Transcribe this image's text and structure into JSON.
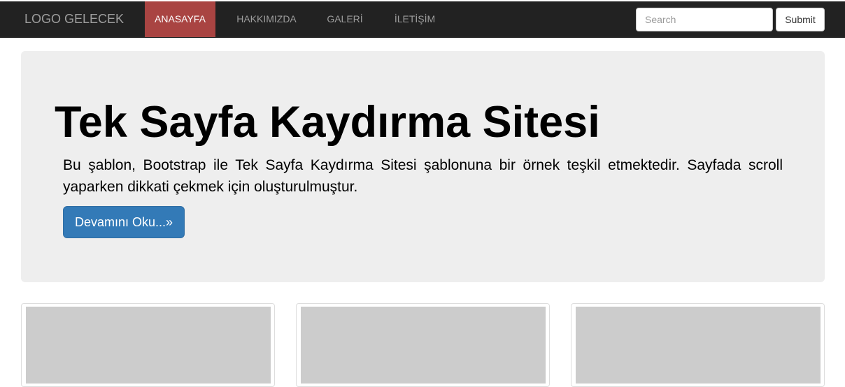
{
  "navbar": {
    "brand": "LOGO GELECEK",
    "items": [
      {
        "label": "ANASAYFA",
        "active": true
      },
      {
        "label": "HAKKIMIZDA",
        "active": false
      },
      {
        "label": "GALERİ",
        "active": false
      },
      {
        "label": "İLETİŞİM",
        "active": false
      }
    ],
    "search": {
      "placeholder": "Search",
      "value": ""
    },
    "submit_label": "Submit"
  },
  "jumbotron": {
    "title": "Tek Sayfa Kaydırma Sitesi",
    "text": "Bu şablon, Bootstrap ile Tek Sayfa Kaydırma Sitesi şablonuna bir örnek teşkil etmektedir. Sayfada scroll yaparken dikkati çekmek için oluşturulmuştur.",
    "button_label": "Devamını Oku...»"
  },
  "colors": {
    "navbar_bg": "#222222",
    "active_nav_bg": "#a94442",
    "jumbotron_bg": "#eeeeee",
    "primary_button": "#337ab7",
    "thumbnail_placeholder": "#cccccc"
  }
}
